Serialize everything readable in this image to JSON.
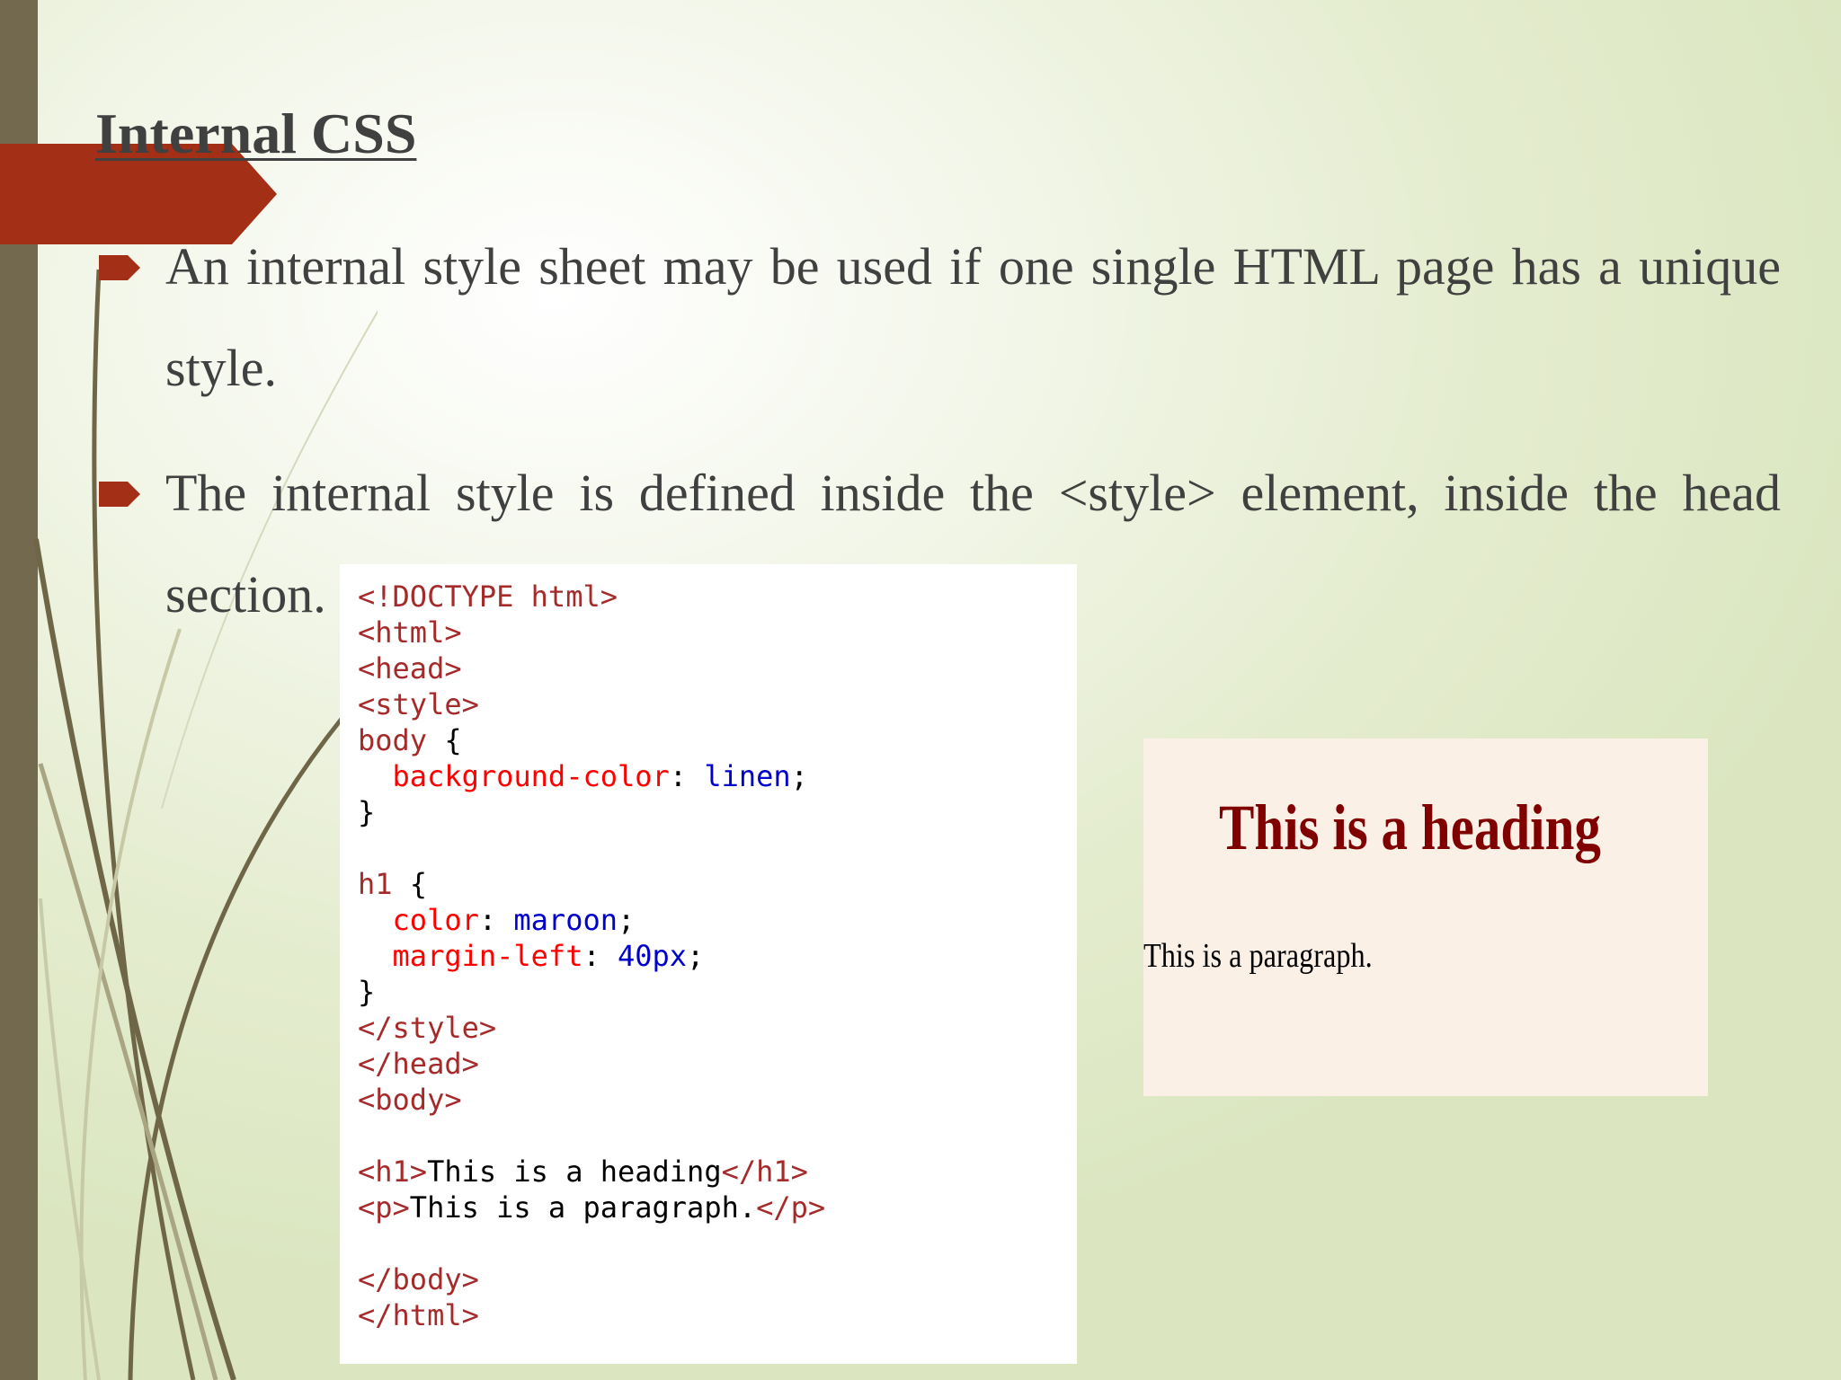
{
  "slide": {
    "title": "Internal CSS",
    "bullets": [
      {
        "text": "An internal style sheet may be used if one single HTML page has a unique style."
      },
      {
        "text": "The internal style is defined inside the <style> element, inside the head section."
      }
    ]
  },
  "code_example": {
    "lines": [
      "<!DOCTYPE html>",
      "<html>",
      "<head>",
      "<style>",
      "body {",
      "  background-color: linen;",
      "}",
      "",
      "h1 {",
      "  color: maroon;",
      "  margin-left: 40px;",
      "}",
      "</style>",
      "</head>",
      "<body>",
      "",
      "<h1>This is a heading</h1>",
      "<p>This is a paragraph.</p>",
      "",
      "</body>",
      "</html>"
    ]
  },
  "rendered_output": {
    "heading": "This is a heading",
    "paragraph": "This is a paragraph.",
    "background_color": "#faf0e6",
    "heading_color": "#800000"
  },
  "theme": {
    "accent": "#a33016",
    "bar": "#73694f",
    "text": "#404040"
  }
}
